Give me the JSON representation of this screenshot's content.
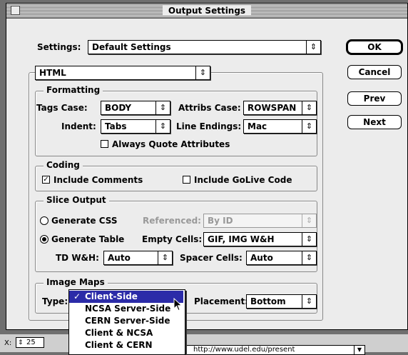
{
  "window": {
    "title": "Output Settings"
  },
  "settings": {
    "label": "Settings:",
    "value": "Default Settings"
  },
  "format_popup": {
    "value": "HTML"
  },
  "buttons": {
    "ok": "OK",
    "cancel": "Cancel",
    "prev": "Prev",
    "next": "Next"
  },
  "formatting": {
    "title": "Formatting",
    "tags_case_label": "Tags Case:",
    "tags_case_value": "BODY",
    "attribs_case_label": "Attribs Case:",
    "attribs_case_value": "ROWSPAN",
    "indent_label": "Indent:",
    "indent_value": "Tabs",
    "line_endings_label": "Line Endings:",
    "line_endings_value": "Mac",
    "always_quote_label": "Always Quote Attributes",
    "always_quote_checked": false
  },
  "coding": {
    "title": "Coding",
    "include_comments_label": "Include Comments",
    "include_comments_checked": true,
    "include_golive_label": "Include GoLive Code",
    "include_golive_checked": false
  },
  "slice_output": {
    "title": "Slice Output",
    "generate_css_label": "Generate CSS",
    "referenced_label": "Referenced:",
    "referenced_value": "By ID",
    "generate_table_label": "Generate Table",
    "empty_cells_label": "Empty Cells:",
    "empty_cells_value": "GIF, IMG W&H",
    "td_wh_label": "TD W&H:",
    "td_wh_value": "Auto",
    "spacer_cells_label": "Spacer Cells:",
    "spacer_cells_value": "Auto",
    "selected": "Generate Table"
  },
  "image_maps": {
    "title": "Image Maps",
    "type_label": "Type:",
    "placement_label": "Placement:",
    "placement_value": "Bottom"
  },
  "type_menu": {
    "check": "✓",
    "items": [
      "Client-Side",
      "NCSA Server-Side",
      "CERN Server-Side",
      "Client & NCSA",
      "Client & CERN"
    ],
    "selected": "Client-Side"
  },
  "bottom": {
    "x_label": "X:",
    "x_value": "25",
    "url": "http://www.udel.edu/present"
  },
  "icons": {
    "popup_arrows": "⇕",
    "checkmark": "☑",
    "cursor": "arrow-cursor"
  }
}
